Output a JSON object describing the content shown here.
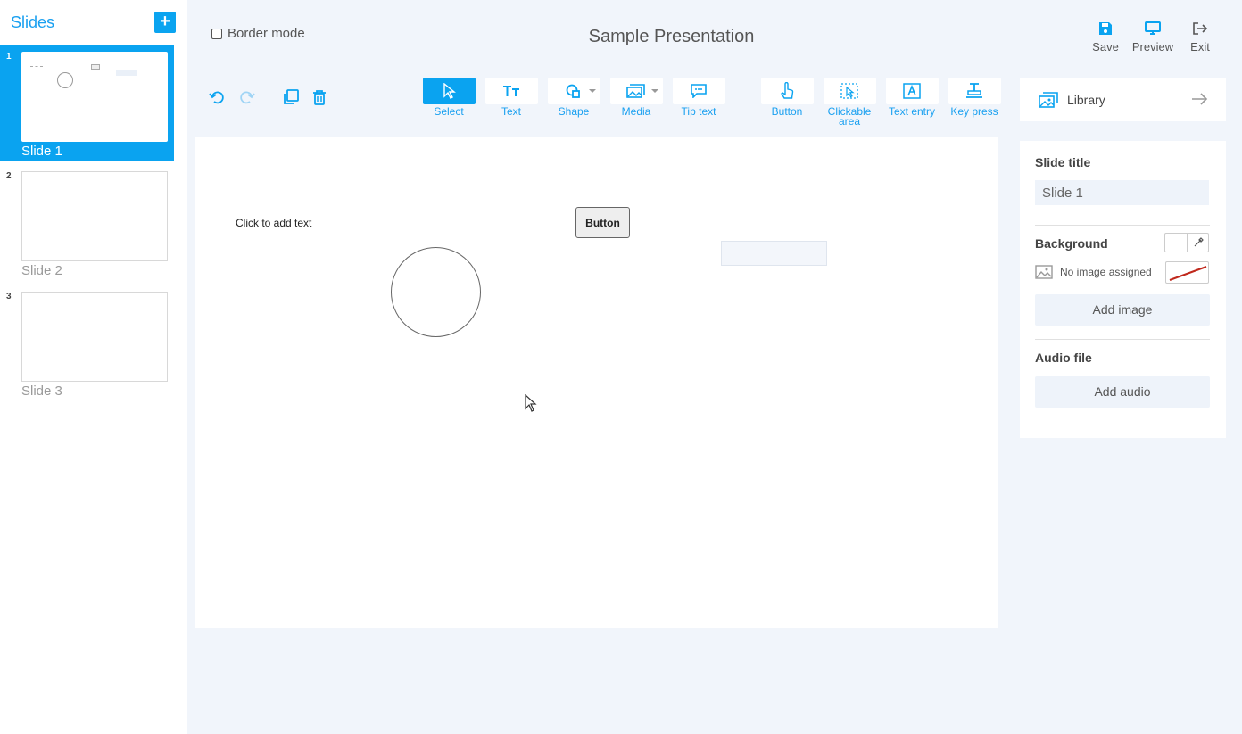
{
  "slides_panel": {
    "title": "Slides",
    "add_label": "+",
    "items": [
      {
        "number": "1",
        "label": "Slide 1",
        "active": true
      },
      {
        "number": "2",
        "label": "Slide 2",
        "active": false
      },
      {
        "number": "3",
        "label": "Slide 3",
        "active": false
      }
    ]
  },
  "header": {
    "border_mode_label": "Border mode",
    "presentation_title": "Sample Presentation",
    "actions": {
      "save": "Save",
      "preview": "Preview",
      "exit": "Exit"
    }
  },
  "toolbar": {
    "tools": {
      "select": "Select",
      "text": "Text",
      "shape": "Shape",
      "media": "Media",
      "tip_text": "Tip text",
      "button": "Button",
      "clickable_area": "Clickable area",
      "text_entry": "Text entry",
      "key_press": "Key press"
    },
    "library": "Library"
  },
  "canvas": {
    "text_placeholder": "Click to add text",
    "button_label": "Button"
  },
  "properties": {
    "slide_title_heading": "Slide title",
    "slide_title_value": "Slide 1",
    "background_heading": "Background",
    "no_image_label": "No image assigned",
    "add_image": "Add image",
    "audio_heading": "Audio file",
    "add_audio": "Add audio"
  },
  "colors": {
    "accent": "#0aa3f0",
    "background": "#f1f5fb",
    "text_dark": "#444444"
  },
  "icons": {
    "undo": "undo-icon",
    "redo": "redo-icon",
    "duplicate": "duplicate-icon",
    "delete": "trash-icon",
    "save": "floppy-disk-icon",
    "preview": "monitor-icon",
    "exit": "exit-arrow-icon",
    "library": "images-icon"
  }
}
